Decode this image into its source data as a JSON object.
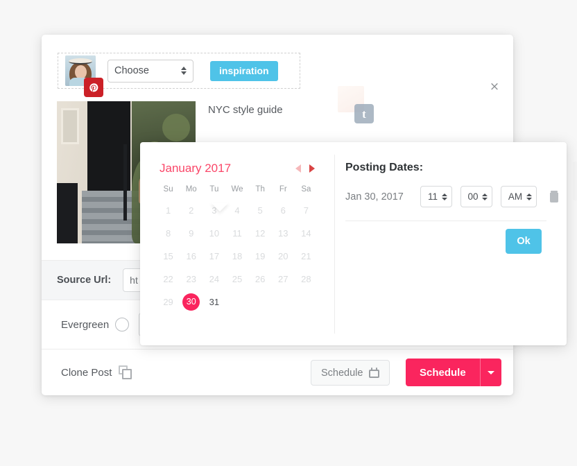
{
  "modal": {
    "close_label": "×",
    "account": {
      "avatar_name": "user-avatar",
      "network_badge": "pinterest",
      "board_select_value": "Choose",
      "tag_label": "inspiration"
    },
    "second_account": {
      "network_badge": "tumblr",
      "badge_glyph": "t"
    },
    "post": {
      "title": "NYC style guide"
    },
    "source": {
      "label": "Source Url:",
      "value": "ht",
      "placeholder": "http://"
    },
    "evergreen": {
      "label": "Evergreen"
    },
    "footer": {
      "clone_label": "Clone Post",
      "schedule_outline_label": "Schedule",
      "schedule_primary_label": "Schedule"
    }
  },
  "picker": {
    "calendar": {
      "month_label": "January 2017",
      "prev_label": "◀",
      "next_label": "▶",
      "dow": [
        "Su",
        "Mo",
        "Tu",
        "We",
        "Th",
        "Fr",
        "Sa"
      ],
      "weeks": [
        [
          {
            "d": "1",
            "state": "disabled"
          },
          {
            "d": "2",
            "state": "disabled"
          },
          {
            "d": "3",
            "state": "disabled"
          },
          {
            "d": "4",
            "state": "disabled"
          },
          {
            "d": "5",
            "state": "disabled"
          },
          {
            "d": "6",
            "state": "disabled"
          },
          {
            "d": "7",
            "state": "disabled"
          }
        ],
        [
          {
            "d": "8",
            "state": "disabled"
          },
          {
            "d": "9",
            "state": "disabled"
          },
          {
            "d": "10",
            "state": "disabled"
          },
          {
            "d": "11",
            "state": "disabled"
          },
          {
            "d": "12",
            "state": "disabled"
          },
          {
            "d": "13",
            "state": "disabled"
          },
          {
            "d": "14",
            "state": "disabled"
          }
        ],
        [
          {
            "d": "15",
            "state": "disabled"
          },
          {
            "d": "16",
            "state": "disabled"
          },
          {
            "d": "17",
            "state": "disabled"
          },
          {
            "d": "18",
            "state": "disabled"
          },
          {
            "d": "19",
            "state": "disabled"
          },
          {
            "d": "20",
            "state": "disabled"
          },
          {
            "d": "21",
            "state": "disabled"
          }
        ],
        [
          {
            "d": "22",
            "state": "disabled"
          },
          {
            "d": "23",
            "state": "disabled"
          },
          {
            "d": "24",
            "state": "disabled"
          },
          {
            "d": "25",
            "state": "disabled"
          },
          {
            "d": "26",
            "state": "disabled"
          },
          {
            "d": "27",
            "state": "disabled"
          },
          {
            "d": "28",
            "state": "disabled"
          }
        ],
        [
          {
            "d": "29",
            "state": "disabled"
          },
          {
            "d": "30",
            "state": "selected"
          },
          {
            "d": "31",
            "state": "enabled"
          },
          {
            "d": "",
            "state": "blank"
          },
          {
            "d": "",
            "state": "blank"
          },
          {
            "d": "",
            "state": "blank"
          },
          {
            "d": "",
            "state": "blank"
          }
        ]
      ]
    },
    "posting": {
      "title": "Posting Dates:",
      "rows": [
        {
          "date": "Jan 30, 2017",
          "hour": "11",
          "minute": "00",
          "meridiem": "AM"
        }
      ],
      "ok_label": "Ok"
    }
  },
  "colors": {
    "accent_pink": "#fa255e",
    "calendar_month": "#fa4668",
    "accent_blue": "#4fc3e8",
    "pinterest_red": "#cb2027",
    "tumblr_grey": "#9fadbc"
  }
}
